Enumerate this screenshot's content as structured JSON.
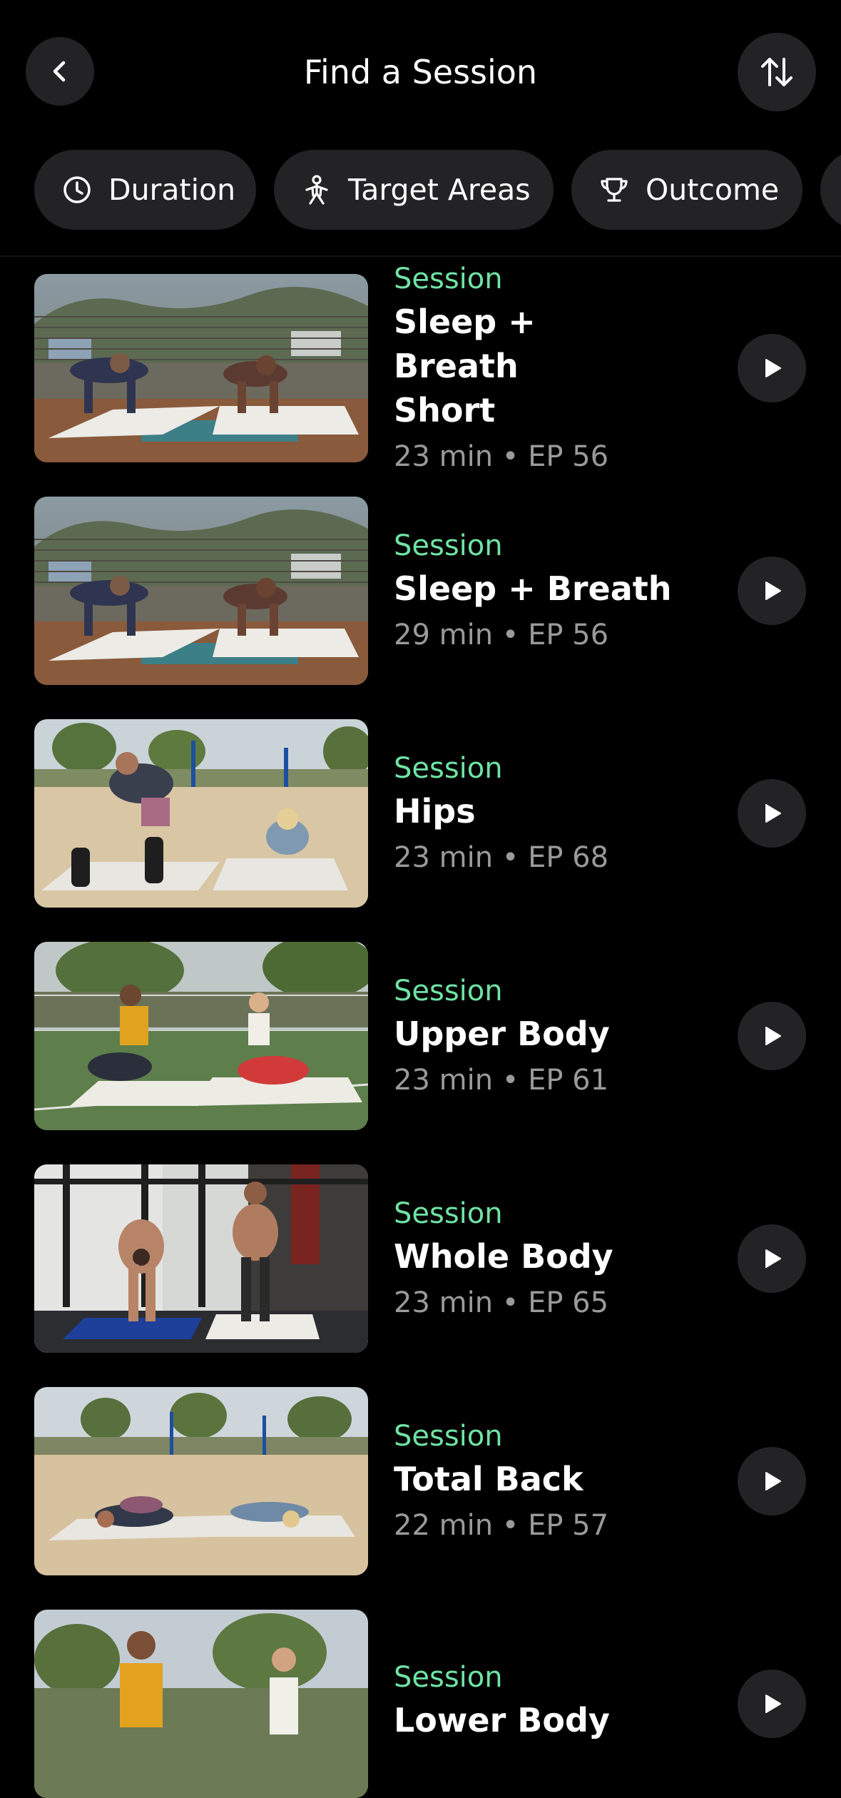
{
  "header": {
    "title": "Find a Session",
    "back_icon": "chevron-left-icon",
    "sort_icon": "sort-arrows-icon"
  },
  "filters": [
    {
      "label": "Duration",
      "icon": "clock-icon"
    },
    {
      "label": "Target Areas",
      "icon": "body-figure-icon"
    },
    {
      "label": "Outcome",
      "icon": "trophy-icon"
    },
    {
      "label": "",
      "icon": ""
    }
  ],
  "colors": {
    "background": "#000000",
    "surface": "#232325",
    "accent": "#6fe3a4",
    "meta": "#9a9a9c"
  },
  "sessions": [
    {
      "kind": "Session",
      "title": "Sleep + Breath Short",
      "meta": "23 min • EP 56",
      "scene": "deck"
    },
    {
      "kind": "Session",
      "title": "Sleep + Breath",
      "meta": "29 min • EP 56",
      "scene": "deck"
    },
    {
      "kind": "Session",
      "title": "Hips",
      "meta": "23 min • EP 68",
      "scene": "beach"
    },
    {
      "kind": "Session",
      "title": "Upper Body",
      "meta": "23 min • EP 61",
      "scene": "court"
    },
    {
      "kind": "Session",
      "title": "Whole Body",
      "meta": "23 min • EP 65",
      "scene": "gym"
    },
    {
      "kind": "Session",
      "title": "Total Back",
      "meta": "22 min • EP 57",
      "scene": "beach2"
    },
    {
      "kind": "Session",
      "title": "Lower Body",
      "meta": "",
      "scene": "park"
    }
  ]
}
